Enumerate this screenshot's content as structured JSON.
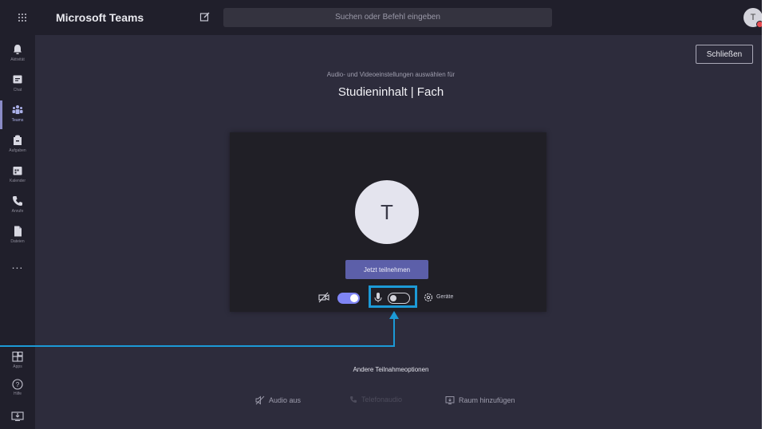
{
  "app": {
    "title": "Microsoft Teams",
    "search_placeholder": "Suchen oder Befehl eingeben",
    "user_initial": "T"
  },
  "rail": {
    "items": [
      {
        "label": "Aktivität",
        "icon": "bell-icon"
      },
      {
        "label": "Chat",
        "icon": "chat-icon"
      },
      {
        "label": "Teams",
        "icon": "teams-icon",
        "active": true
      },
      {
        "label": "Aufgaben",
        "icon": "assignments-icon"
      },
      {
        "label": "Kalender",
        "icon": "calendar-icon"
      },
      {
        "label": "Anrufe",
        "icon": "phone-icon"
      },
      {
        "label": "Dateien",
        "icon": "file-icon"
      }
    ],
    "more": "...",
    "apps_label": "Apps",
    "help_label": "Hilfe"
  },
  "main": {
    "close_label": "Schließen",
    "subtitle": "Audio- und Videoeinstellungen auswählen für",
    "meeting_title": "Studieninhalt | Fach",
    "avatar_initial": "T",
    "join_label": "Jetzt teilnehmen",
    "camera_on": true,
    "mic_on": false,
    "devices_label": "Geräte",
    "other_options_title": "Andere Teilnahmeoptionen",
    "option_audio_off": "Audio aus",
    "option_phone_audio": "Telefonaudio",
    "option_add_room": "Raum hinzufügen"
  },
  "colors": {
    "accent": "#5c5fa9",
    "callout": "#1c9ad6",
    "background": "#2d2c3c",
    "rail": "#201f2b"
  }
}
